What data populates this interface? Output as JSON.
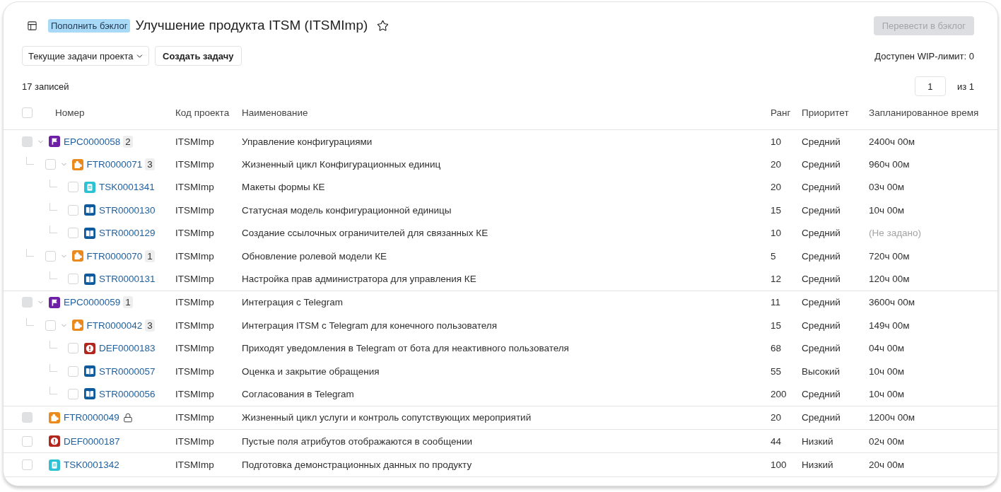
{
  "header": {
    "tag": "Пополнить бэклог",
    "title": "Улучшение продукта ITSM (ITSMImp)",
    "starred": false,
    "move_button": {
      "label": "Перевести в бэклог",
      "disabled": true
    }
  },
  "toolbar": {
    "filter_dropdown": {
      "value": "Текущие задачи проекта"
    },
    "create_button": {
      "label": "Создать задачу"
    },
    "wip_limit": "Доступен WIP-лимит: 0"
  },
  "summary": {
    "record_count": "17 записей",
    "pagination": {
      "page": "1",
      "total": "из 1"
    }
  },
  "table": {
    "select_all": {
      "checked": false
    },
    "columns": [
      "Номер",
      "Код проекта",
      "Наименование",
      "Ранг",
      "Приоритет",
      "Запланированное время"
    ],
    "rows": [
      {
        "kind": "epic",
        "number": "EPC0000058",
        "count": "2",
        "checked": false,
        "disabled": true,
        "expanded": true,
        "locked": false,
        "project": "ITSMImp",
        "name": "Управление конфигурациями",
        "rank": "10",
        "priority": "Средний",
        "planned_time": "2400ч 00м",
        "children": [
          {
            "kind": "feature",
            "number": "FTR0000071",
            "count": "3",
            "checked": false,
            "disabled": false,
            "expanded": true,
            "locked": false,
            "project": "ITSMImp",
            "name": "Жизненный цикл Конфигурационных единиц",
            "rank": "20",
            "priority": "Средний",
            "planned_time": "960ч 00м",
            "children": [
              {
                "kind": "task",
                "number": "TSK0001341",
                "checked": false,
                "disabled": false,
                "locked": false,
                "project": "ITSMImp",
                "name": "Макеты формы КЕ",
                "rank": "20",
                "priority": "Средний",
                "planned_time": "03ч 00м"
              },
              {
                "kind": "story",
                "number": "STR0000130",
                "checked": false,
                "disabled": false,
                "locked": false,
                "project": "ITSMImp",
                "name": "Статусная модель конфигурационной единицы",
                "rank": "15",
                "priority": "Средний",
                "planned_time": "10ч 00м"
              },
              {
                "kind": "story",
                "number": "STR0000129",
                "checked": false,
                "disabled": false,
                "locked": false,
                "project": "ITSMImp",
                "name": "Создание ссылочных ограничителей для связанных КЕ",
                "rank": "10",
                "priority": "Средний",
                "planned_time_placeholder": "(Не задано)"
              }
            ]
          },
          {
            "kind": "feature",
            "number": "FTR0000070",
            "count": "1",
            "checked": false,
            "disabled": false,
            "expanded": true,
            "locked": false,
            "project": "ITSMImp",
            "name": "Обновление ролевой модели КЕ",
            "rank": "5",
            "priority": "Средний",
            "planned_time": "720ч 00м",
            "children": [
              {
                "kind": "story",
                "number": "STR0000131",
                "checked": false,
                "disabled": false,
                "locked": false,
                "project": "ITSMImp",
                "name": "Настройка прав администратора для управления КЕ",
                "rank": "12",
                "priority": "Средний",
                "planned_time": "120ч 00м"
              }
            ]
          }
        ]
      },
      {
        "kind": "epic",
        "number": "EPC0000059",
        "count": "1",
        "checked": false,
        "disabled": true,
        "expanded": true,
        "locked": false,
        "project": "ITSMImp",
        "name": "Интеграция с Telegram",
        "rank": "11",
        "priority": "Средний",
        "planned_time": "3600ч 00м",
        "children": [
          {
            "kind": "feature",
            "number": "FTR0000042",
            "count": "3",
            "checked": false,
            "disabled": false,
            "expanded": true,
            "locked": false,
            "project": "ITSMImp",
            "name": "Интеграция ITSM с Telegram для конечного пользователя",
            "rank": "15",
            "priority": "Средний",
            "planned_time": "149ч 00м",
            "children": [
              {
                "kind": "defect",
                "number": "DEF0000183",
                "checked": false,
                "disabled": false,
                "locked": false,
                "project": "ITSMImp",
                "name": "Приходят уведомления в Telegram от бота для неактивного пользователя",
                "rank": "68",
                "priority": "Средний",
                "planned_time": "04ч 00м"
              },
              {
                "kind": "story",
                "number": "STR0000057",
                "checked": false,
                "disabled": false,
                "locked": false,
                "project": "ITSMImp",
                "name": "Оценка и закрытие обращения",
                "rank": "55",
                "priority": "Высокий",
                "planned_time": "10ч 00м"
              },
              {
                "kind": "story",
                "number": "STR0000056",
                "checked": false,
                "disabled": false,
                "locked": false,
                "project": "ITSMImp",
                "name": "Согласования в Telegram",
                "rank": "200",
                "priority": "Средний",
                "planned_time": "10ч 00м"
              }
            ]
          }
        ]
      },
      {
        "kind": "feature",
        "number": "FTR0000049",
        "checked": false,
        "disabled": true,
        "locked": true,
        "project": "ITSMImp",
        "name": "Жизненный цикл услуги и контроль сопутствующих мероприятий",
        "rank": "20",
        "priority": "Средний",
        "planned_time": "1200ч 00м"
      },
      {
        "kind": "defect",
        "number": "DEF0000187",
        "checked": false,
        "disabled": false,
        "locked": false,
        "project": "ITSMImp",
        "name": "Пустые поля атрибутов отображаются в сообщении",
        "rank": "44",
        "priority": "Низкий",
        "planned_time": "02ч 00м"
      },
      {
        "kind": "task",
        "number": "TSK0001342",
        "checked": false,
        "disabled": false,
        "locked": false,
        "project": "ITSMImp",
        "name": "Подготовка демонстрационных данных по продукту",
        "rank": "100",
        "priority": "Низкий",
        "planned_time": "20ч 00м"
      }
    ]
  }
}
